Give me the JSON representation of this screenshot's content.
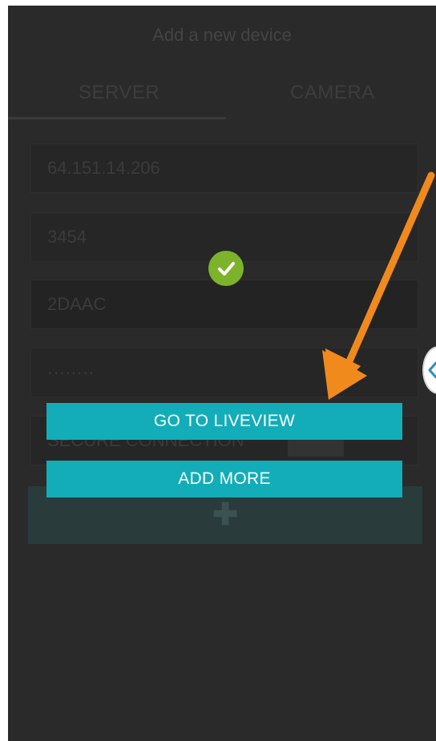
{
  "header": {
    "title": "Add a new device"
  },
  "tabs": [
    {
      "label": "SERVER",
      "selected": true
    },
    {
      "label": "CAMERA",
      "selected": false
    }
  ],
  "form": {
    "address": "64.151.14.206",
    "port": "3454",
    "username": "2DAAC",
    "password": "········",
    "secure_connection": "SECURE CONNECTION"
  },
  "dialog": {
    "success_icon": "check-circle-icon",
    "go_liveview_label": "GO TO LIVEVIEW",
    "add_more_label": "ADD MORE"
  },
  "add_button_icon": "plus-icon",
  "annotation": {
    "arrow_color": "#f08a1c",
    "arrow_icon": "arrow-annotation"
  },
  "colors": {
    "accent": "#12adb8",
    "success": "#7cb32a",
    "background": "#2a2a2a"
  }
}
